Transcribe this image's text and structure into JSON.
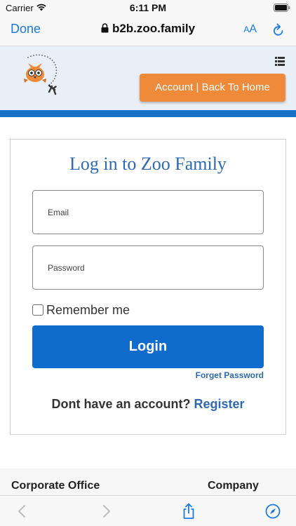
{
  "status_bar": {
    "carrier": "Carrier",
    "time": "6:11 PM"
  },
  "browser": {
    "done_label": "Done",
    "url": "b2b.zoo.family",
    "text_size_label_small": "A",
    "text_size_label_large": "A",
    "accent_color": "#1a7ae6"
  },
  "header": {
    "account_button_label": "Account | Back To Home",
    "account_button_color": "#ee8a3a",
    "stripe_color": "#1673c8"
  },
  "login": {
    "title": "Log in to Zoo Family",
    "email_placeholder": "Email",
    "password_placeholder": "Password",
    "remember_label": "Remember me",
    "remember_checked": false,
    "login_button_label": "Login",
    "forget_password_label": "Forget Password",
    "no_account_text": "Dont have an account?",
    "register_label": "Register",
    "button_color": "#0f6ccd"
  },
  "footer": {
    "corporate_label": "Corporate Office",
    "company_label": "Company"
  },
  "toolbar": {
    "icons": [
      "back-icon",
      "forward-icon",
      "share-icon",
      "compass-icon"
    ]
  }
}
